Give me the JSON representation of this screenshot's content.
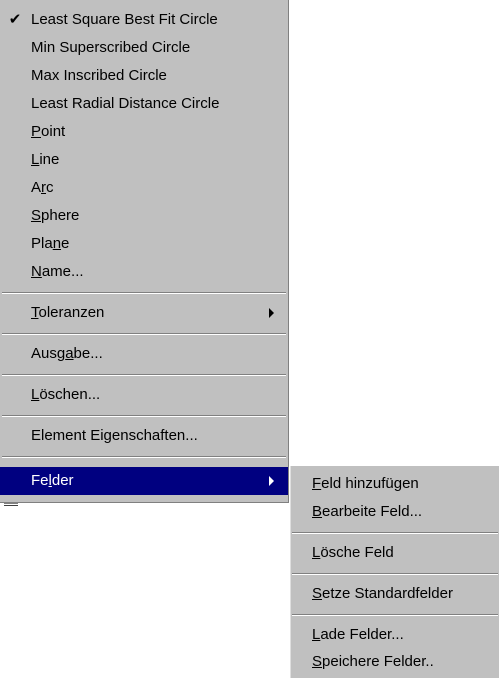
{
  "main_menu": {
    "items": [
      {
        "label": "Least Square Best Fit Circle",
        "checked": true
      },
      {
        "label": "Min Superscribed Circle"
      },
      {
        "label": "Max Inscribed Circle"
      },
      {
        "label": "Least Radial Distance Circle"
      },
      {
        "label": "Point",
        "mnemonic": "P"
      },
      {
        "label": "Line",
        "mnemonic": "L"
      },
      {
        "label": "Arc",
        "mnemonic": "r"
      },
      {
        "label": "Sphere",
        "mnemonic": "S"
      },
      {
        "label": "Plane",
        "mnemonic": "n"
      },
      {
        "label": "Name...",
        "mnemonic": "N"
      },
      {
        "label": "Toleranzen",
        "mnemonic": "T",
        "submenu": true
      },
      {
        "label": "Ausgabe...",
        "mnemonic": "g"
      },
      {
        "label": "Löschen...",
        "mnemonic": "L"
      },
      {
        "label": "Element Eigenschaften...",
        "mnemonic": "g"
      },
      {
        "label": "Felder",
        "mnemonic": "l",
        "submenu": true,
        "highlighted": true
      }
    ],
    "check_glyph": "✔"
  },
  "sub_menu": {
    "items": [
      {
        "label": "Feld hinzufügen",
        "mnemonic": "F"
      },
      {
        "label": "Bearbeite Feld...",
        "mnemonic": "B"
      },
      {
        "label": "Lösche Feld",
        "mnemonic": "L"
      },
      {
        "label": "Setze Standardfelder",
        "mnemonic": "S"
      },
      {
        "label": "Lade Felder...",
        "mnemonic": "L"
      },
      {
        "label": "Speichere Felder..",
        "mnemonic": "S"
      }
    ]
  },
  "colors": {
    "menu_background": "#c0c0c0",
    "highlight": "#000080",
    "highlight_text": "#ffffff"
  }
}
